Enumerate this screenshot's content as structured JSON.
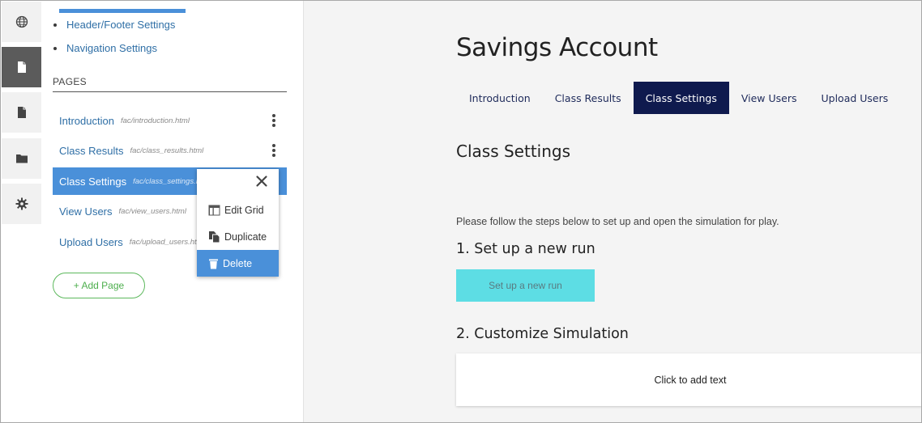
{
  "rail": {
    "items": [
      {
        "icon": "globe-icon"
      },
      {
        "icon": "page-icon",
        "active": true
      },
      {
        "icon": "document-icon"
      },
      {
        "icon": "folder-icon"
      },
      {
        "icon": "gear-icon"
      }
    ]
  },
  "settings_links": [
    "Header/Footer Settings",
    "Navigation Settings"
  ],
  "pages": {
    "heading": "PAGES",
    "items": [
      {
        "name": "Introduction",
        "path": "fac/introduction.html"
      },
      {
        "name": "Class Results",
        "path": "fac/class_results.html"
      },
      {
        "name": "Class Settings",
        "path": "fac/class_settings.html"
      },
      {
        "name": "View Users",
        "path": "fac/view_users.html"
      },
      {
        "name": "Upload Users",
        "path": "fac/upload_users.html"
      }
    ],
    "add_label": "+ Add Page"
  },
  "context_menu": {
    "items": [
      "Edit Grid",
      "Duplicate",
      "Delete"
    ],
    "highlighted": "Delete"
  },
  "main": {
    "title": "Savings Account",
    "tabs": [
      "Introduction",
      "Class Results",
      "Class Settings",
      "View Users",
      "Upload Users"
    ],
    "active_tab": "Class Settings",
    "section_title": "Class Settings",
    "instructions": "Please follow the steps below to set up and open the simulation for play.",
    "step1_title": "1. Set up a new run",
    "step1_button": "Set up a new run",
    "step2_title": "2. Customize Simulation",
    "text_placeholder": "Click to add text"
  },
  "colors": {
    "accent_blue": "#4a90d9",
    "tab_active": "#0f1a4e",
    "run_button": "#5ddde4",
    "add_page_green": "#5cb85c"
  }
}
